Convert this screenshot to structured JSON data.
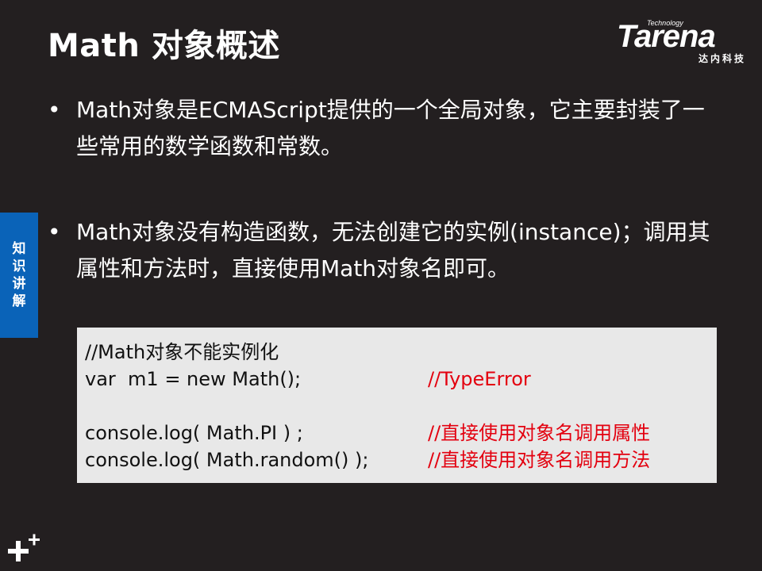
{
  "slide": {
    "title": "Math 对象概述",
    "logo": {
      "technology": "Technology",
      "brand": "Tarena",
      "subtitle": "达内科技"
    },
    "side_tab": [
      "知",
      "识",
      "讲",
      "解"
    ],
    "bullets": [
      {
        "symbol": "•",
        "text": "Math对象是ECMAScript提供的一个全局对象，它主要封装了一些常用的数学函数和常数。"
      },
      {
        "symbol": "•",
        "text": "Math对象没有构造函数，无法创建它的实例(instance)；调用其属性和方法时，直接使用Math对象名即可。"
      }
    ],
    "code": {
      "lines": [
        {
          "code": "//Math对象不能实例化",
          "comment": ""
        },
        {
          "code": "var  m1 = new Math();",
          "comment": "//TypeError"
        },
        {
          "code": "",
          "comment": ""
        },
        {
          "code": "console.log( Math.PI ) ;",
          "comment": "//直接使用对象名调用属性"
        },
        {
          "code": "console.log( Math.random() );",
          "comment": "//直接使用对象名调用方法"
        }
      ]
    },
    "colors": {
      "background": "#231f20",
      "side_tab": "#0a63b8",
      "code_bg": "#e8e8e8",
      "comment": "#e3000f"
    },
    "icons": {
      "corner": "plus-icon"
    }
  }
}
